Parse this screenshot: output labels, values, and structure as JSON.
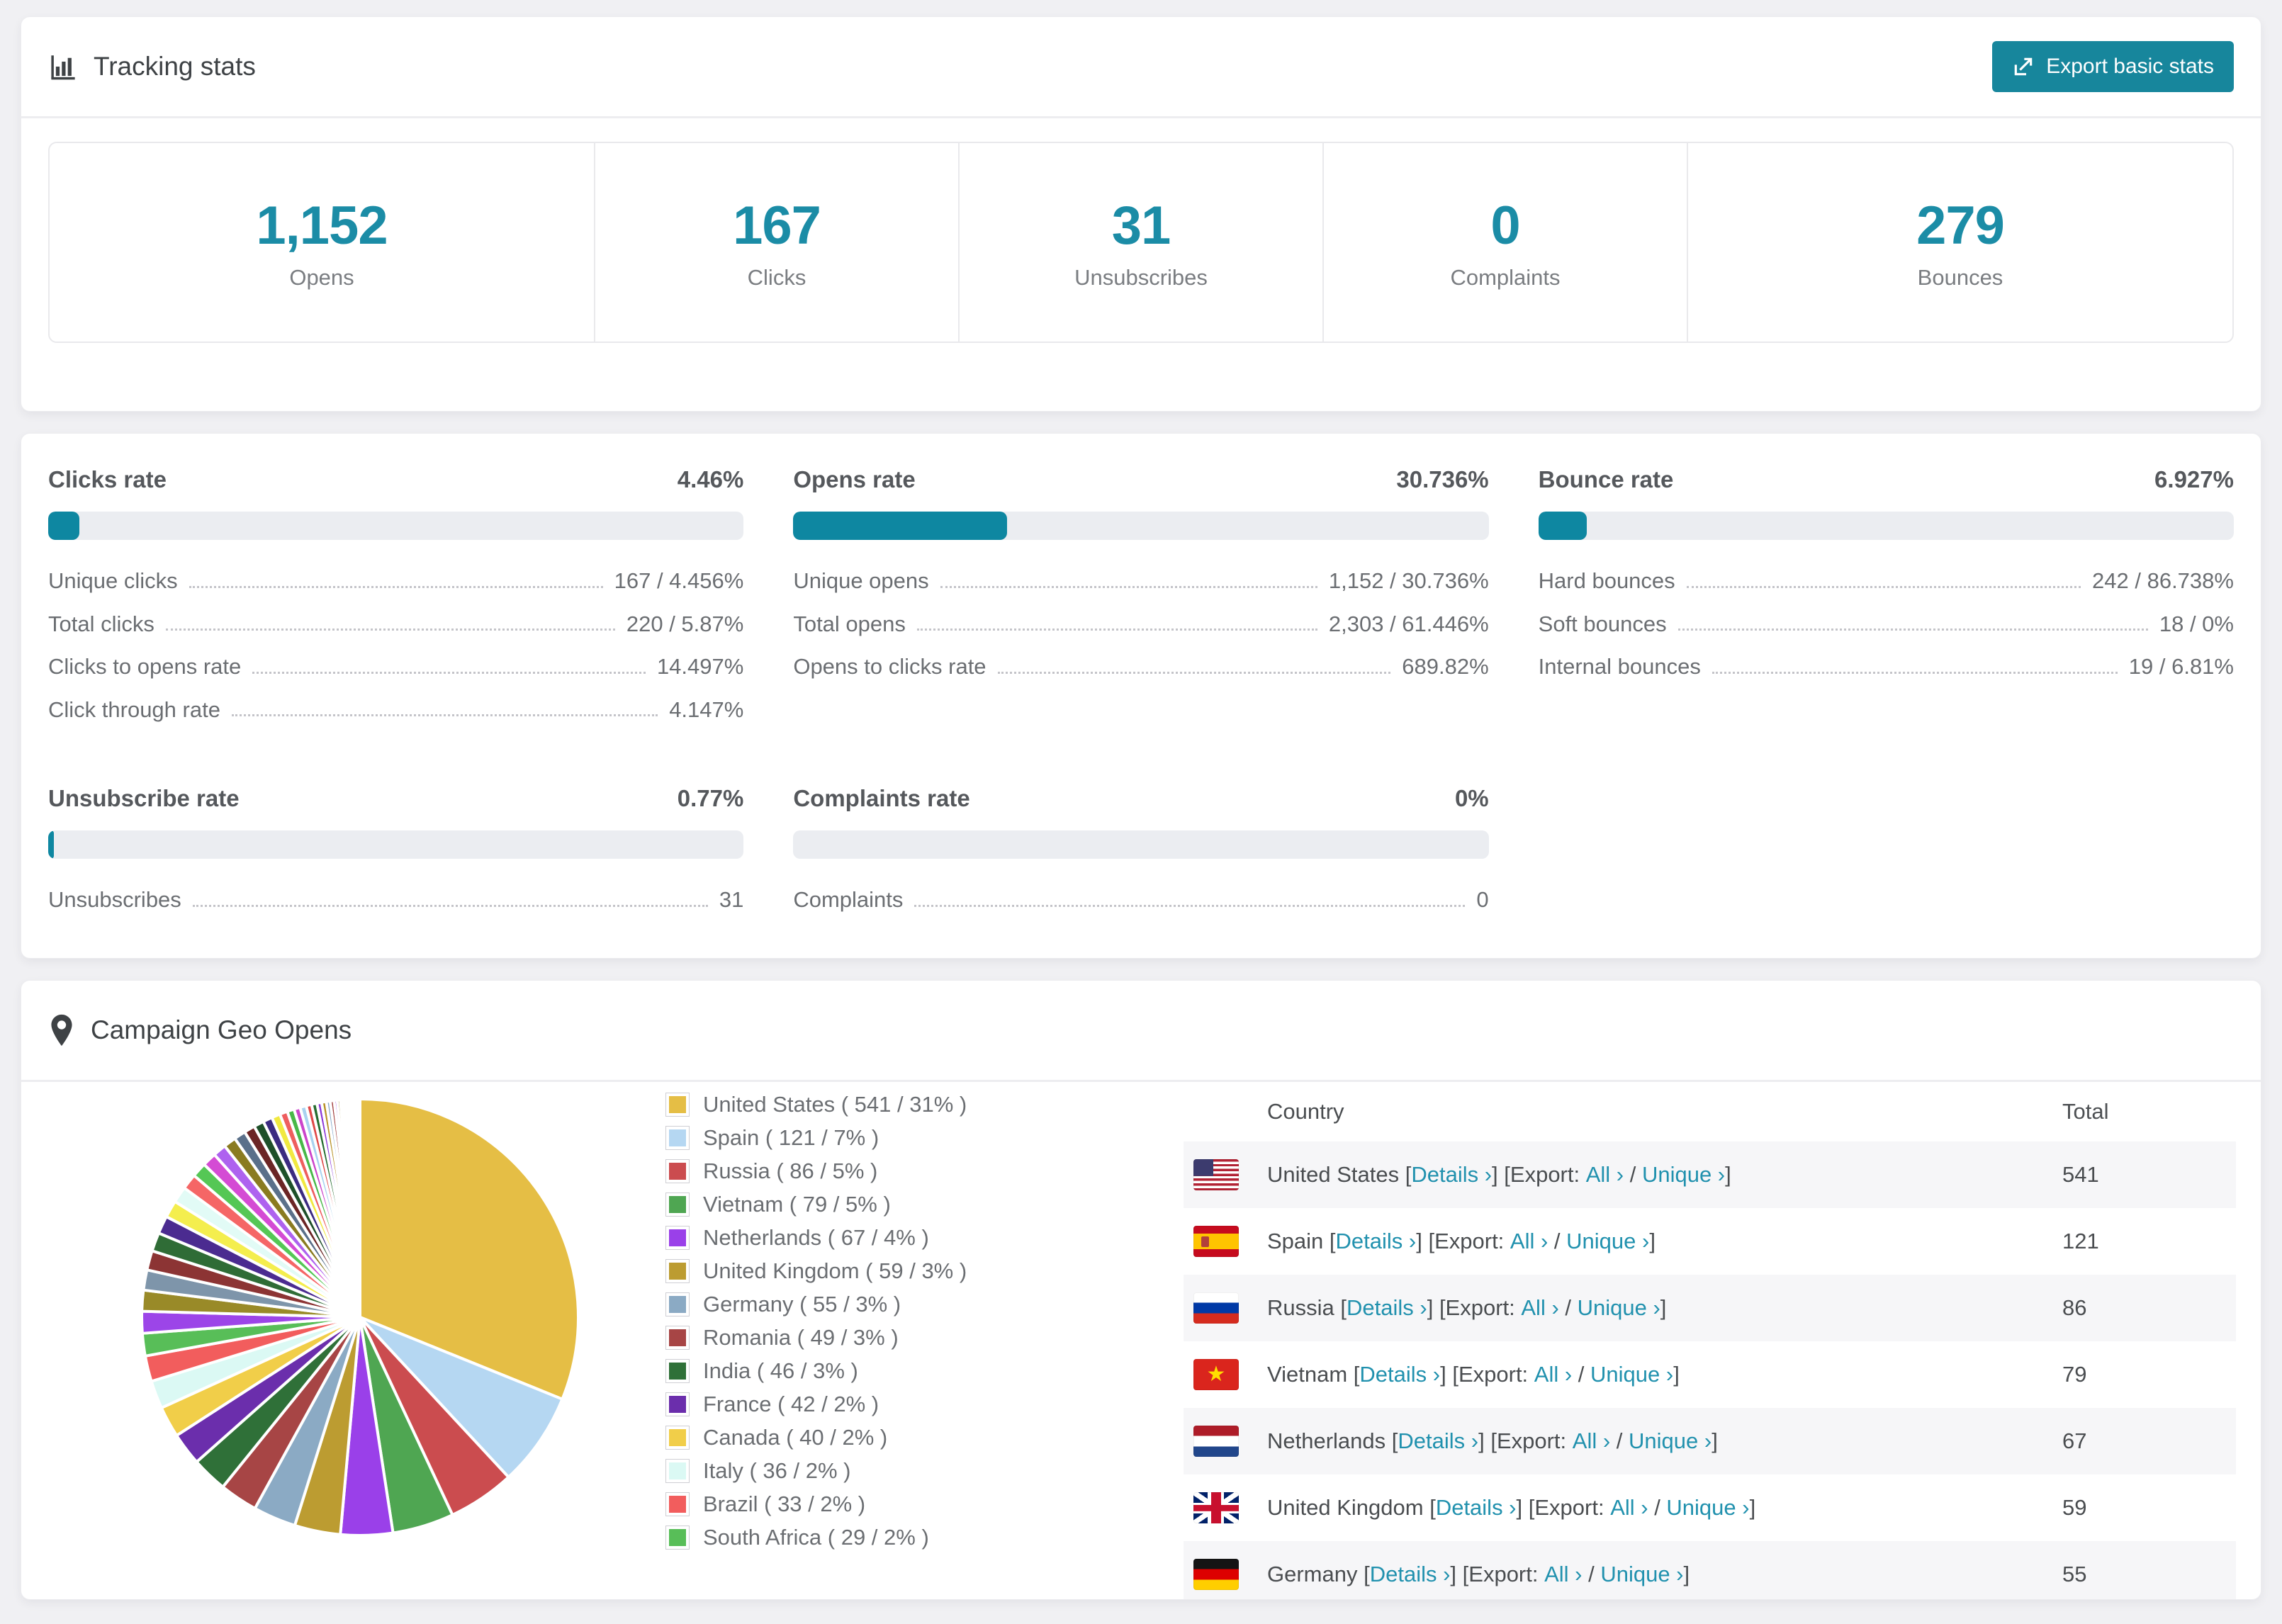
{
  "accent": "#17869C",
  "tracking": {
    "title": "Tracking stats",
    "export_button": "Export basic stats",
    "stats": [
      {
        "value": "1,152",
        "label": "Opens"
      },
      {
        "value": "167",
        "label": "Clicks"
      },
      {
        "value": "31",
        "label": "Unsubscribes"
      },
      {
        "value": "0",
        "label": "Complaints"
      },
      {
        "value": "279",
        "label": "Bounces"
      }
    ]
  },
  "rates": [
    {
      "title": "Clicks rate",
      "value": "4.46%",
      "pct": 4.46,
      "rows": [
        {
          "label": "Unique clicks",
          "value": "167 / 4.456%"
        },
        {
          "label": "Total clicks",
          "value": "220 / 5.87%"
        },
        {
          "label": "Clicks to opens rate",
          "value": "14.497%"
        },
        {
          "label": "Click through rate",
          "value": "4.147%"
        }
      ]
    },
    {
      "title": "Opens rate",
      "value": "30.736%",
      "pct": 30.736,
      "rows": [
        {
          "label": "Unique opens",
          "value": "1,152 / 30.736%"
        },
        {
          "label": "Total opens",
          "value": "2,303 / 61.446%"
        },
        {
          "label": "Opens to clicks rate",
          "value": "689.82%"
        }
      ]
    },
    {
      "title": "Bounce rate",
      "value": "6.927%",
      "pct": 6.927,
      "rows": [
        {
          "label": "Hard bounces",
          "value": "242 / 86.738%"
        },
        {
          "label": "Soft bounces",
          "value": "18 / 0%"
        },
        {
          "label": "Internal bounces",
          "value": "19 / 6.81%"
        }
      ]
    },
    {
      "title": "Unsubscribe rate",
      "value": "0.77%",
      "pct": 0.77,
      "rows": [
        {
          "label": "Unsubscribes",
          "value": "31"
        }
      ]
    },
    {
      "title": "Complaints rate",
      "value": "0%",
      "pct": 0,
      "rows": [
        {
          "label": "Complaints",
          "value": "0"
        }
      ]
    }
  ],
  "geo": {
    "title": "Campaign Geo Opens",
    "legend_item_format": "{name} ( {count} / {pct}% )",
    "chart_data": {
      "type": "pie",
      "title": "Campaign Geo Opens",
      "start_angle_deg": -90,
      "direction": "clockwise",
      "legend_position": "right",
      "slices": [
        {
          "name": "United States",
          "count": 541,
          "pct": 31,
          "color": "#E5BE45"
        },
        {
          "name": "Spain",
          "count": 121,
          "pct": 7,
          "color": "#B5D7F2"
        },
        {
          "name": "Russia",
          "count": 86,
          "pct": 5,
          "color": "#CB4C4F"
        },
        {
          "name": "Vietnam",
          "count": 79,
          "pct": 5,
          "color": "#4FA652"
        },
        {
          "name": "Netherlands",
          "count": 67,
          "pct": 4,
          "color": "#9A40E9"
        },
        {
          "name": "United Kingdom",
          "count": 59,
          "pct": 3,
          "color": "#BC9C31"
        },
        {
          "name": "Germany",
          "count": 55,
          "pct": 3,
          "color": "#8BAAC4"
        },
        {
          "name": "Romania",
          "count": 49,
          "pct": 3,
          "color": "#A74545"
        },
        {
          "name": "India",
          "count": 46,
          "pct": 3,
          "color": "#2F7038"
        },
        {
          "name": "France",
          "count": 42,
          "pct": 2,
          "color": "#6B2EAC"
        },
        {
          "name": "Canada",
          "count": 40,
          "pct": 2,
          "color": "#F1CE49"
        },
        {
          "name": "Italy",
          "count": 36,
          "pct": 2,
          "color": "#DBF9F4"
        },
        {
          "name": "Brazil",
          "count": 33,
          "pct": 2,
          "color": "#F25D5D"
        },
        {
          "name": "South Africa",
          "count": 29,
          "pct": 2,
          "color": "#58BE58"
        }
      ],
      "others": {
        "note": "remaining small unlabeled countries",
        "values": [
          28,
          27,
          26,
          25,
          24,
          23,
          22,
          21,
          20,
          19,
          18,
          17,
          16,
          15,
          14,
          13,
          12,
          11,
          10,
          9,
          8,
          8,
          7,
          7,
          6,
          6,
          5,
          5,
          4,
          4,
          3,
          3,
          3,
          2,
          2,
          2,
          2,
          1,
          1,
          1,
          1,
          1,
          1,
          1,
          1
        ],
        "colors": [
          "#9C45E8",
          "#998A28",
          "#7E95AA",
          "#8C3434",
          "#2F6C36",
          "#4B2B90",
          "#F4EE4E",
          "#E2FBF6",
          "#F56666",
          "#55C755",
          "#D44BD4",
          "#AE62EF",
          "#8A7B20",
          "#5A708A",
          "#6B2525",
          "#1E5029",
          "#3B2B81",
          "#F1E940",
          "#EE5E5E",
          "#48B848",
          "#CB44CB",
          "#A9D2F0",
          "#DF4848",
          "#256C2F",
          "#8B38D8",
          "#B89228",
          "#89A9C8",
          "#A03D3D"
        ]
      }
    },
    "table": {
      "headers": [
        "Country",
        "Total"
      ],
      "parts": {
        "open_bracket": " [",
        "close_bracket": "]",
        "details": "Details ›",
        "export_prefix": " [Export: ",
        "all": "All ›",
        "slash": " / ",
        "unique": "Unique ›"
      },
      "rows": [
        {
          "country": "United States",
          "flag": "us",
          "total": "541"
        },
        {
          "country": "Spain",
          "flag": "es",
          "total": "121"
        },
        {
          "country": "Russia",
          "flag": "ru",
          "total": "86"
        },
        {
          "country": "Vietnam",
          "flag": "vn",
          "total": "79"
        },
        {
          "country": "Netherlands",
          "flag": "nl",
          "total": "67"
        },
        {
          "country": "United Kingdom",
          "flag": "gb",
          "total": "59"
        },
        {
          "country": "Germany",
          "flag": "de",
          "total": "55"
        }
      ]
    }
  }
}
